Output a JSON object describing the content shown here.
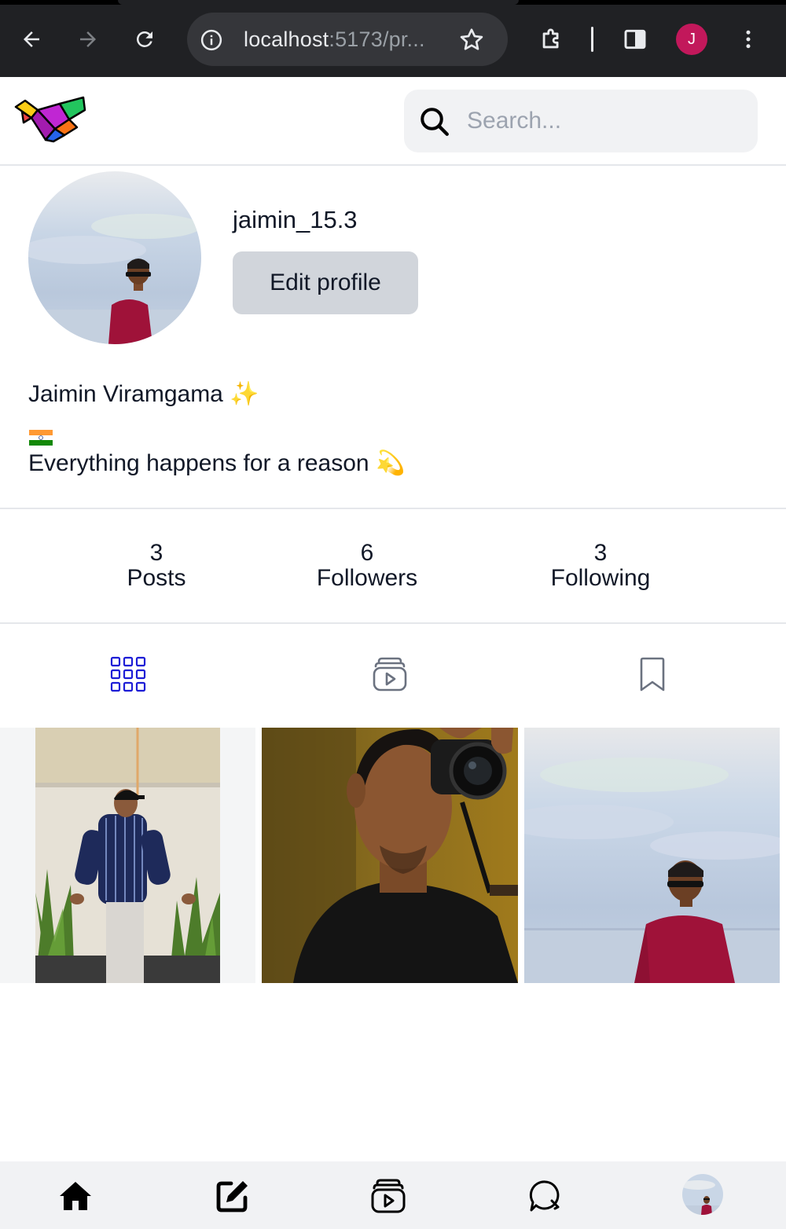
{
  "browser": {
    "url_host": "localhost",
    "url_rest": ":5173/pr...",
    "profile_initial": "J",
    "icons": [
      "back-arrow-icon",
      "forward-arrow-icon",
      "reload-icon",
      "site-info-icon",
      "bookmark-star-icon",
      "extensions-icon",
      "side-panel-icon",
      "more-vert-icon"
    ]
  },
  "header": {
    "search_placeholder": "Search...",
    "logo": "origami-bird-logo"
  },
  "profile": {
    "username": "jaimin_15.3",
    "edit_label": "Edit profile",
    "full_name": "Jaimin Viramgama ✨",
    "bio_line1": "🇮🇳",
    "bio_line2": "Everything happens for a reason 💫"
  },
  "stats": [
    {
      "value": "3",
      "label": "Posts"
    },
    {
      "value": "6",
      "label": "Followers"
    },
    {
      "value": "3",
      "label": "Following"
    }
  ],
  "tabs": [
    {
      "icon": "grid-icon",
      "active": true
    },
    {
      "icon": "reels-icon",
      "active": false
    },
    {
      "icon": "saved-bookmark-icon",
      "active": false
    }
  ],
  "posts": [
    "post-photo-1",
    "post-photo-2",
    "post-photo-3"
  ],
  "bottom_nav": [
    {
      "icon": "home-icon"
    },
    {
      "icon": "create-post-icon"
    },
    {
      "icon": "reels-icon"
    },
    {
      "icon": "messages-icon"
    },
    {
      "icon": "profile-avatar"
    }
  ],
  "colors": {
    "accent": "#1d1dd6",
    "chrome_bg": "#202124",
    "edit_button": "#d1d5db",
    "search_bg": "#f1f2f4"
  }
}
